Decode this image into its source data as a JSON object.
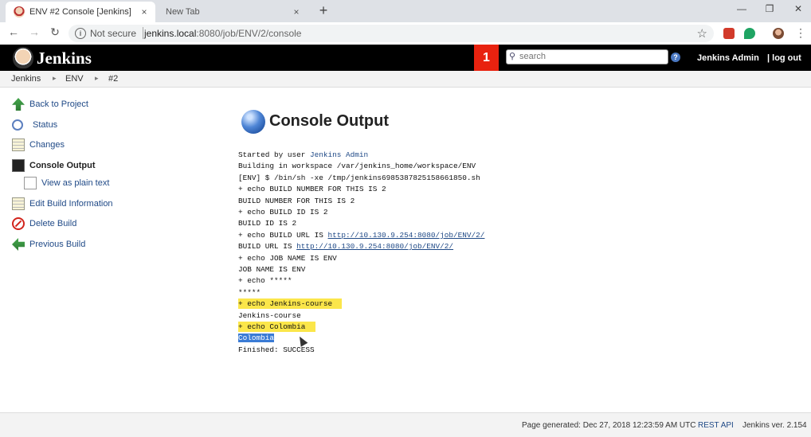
{
  "browser": {
    "tabs": [
      {
        "title": "ENV #2 Console [Jenkins]",
        "close": "×"
      },
      {
        "title": "New Tab",
        "close": "×"
      }
    ],
    "new_tab": "+",
    "window_controls": {
      "minimize": "—",
      "restore": "❐",
      "close": "✕"
    },
    "nav": {
      "back": "←",
      "forward": "→",
      "reload": "↻"
    },
    "address": {
      "security_label": "Not secure",
      "host": "jenkins.local",
      "rest": ":8080/job/ENV/2/console"
    },
    "star": "☆",
    "menu": "⋮"
  },
  "header": {
    "title": "Jenkins",
    "notification_count": "1",
    "search": {
      "placeholder": "search",
      "icon": "search-icon"
    },
    "help": "?",
    "user": "Jenkins Admin",
    "logout": "| log out"
  },
  "breadcrumbs": [
    "Jenkins",
    "ENV",
    "#2"
  ],
  "breadcrumb_separator": "▸",
  "sidebar": {
    "items": [
      {
        "label": "Back to Project",
        "icon": "up-arrow-icon"
      },
      {
        "label": "Status",
        "icon": "search-icon"
      },
      {
        "label": "Changes",
        "icon": "notepad-icon"
      },
      {
        "label": "Console Output",
        "icon": "terminal-icon"
      },
      {
        "label": "View as plain text",
        "icon": "page-icon"
      },
      {
        "label": "Edit Build Information",
        "icon": "notepad-icon"
      },
      {
        "label": "Delete Build",
        "icon": "delete-icon"
      },
      {
        "label": "Previous Build",
        "icon": "left-arrow-icon"
      }
    ]
  },
  "main": {
    "title": "Console Output",
    "console": {
      "started_prefix": "Started by user ",
      "started_user": "Jenkins Admin",
      "lines_a": [
        "Building in workspace /var/jenkins_home/workspace/ENV",
        "[ENV] $ /bin/sh -xe /tmp/jenkins6985387825158661850.sh",
        "+ echo BUILD NUMBER FOR THIS IS 2",
        "BUILD NUMBER FOR THIS IS 2",
        "+ echo BUILD ID IS 2",
        "BUILD ID IS 2"
      ],
      "build_url_echo_prefix": "+ echo BUILD URL IS ",
      "build_url_prefix": "BUILD URL IS ",
      "build_url": "http://10.130.9.254:8080/job/ENV/2/",
      "lines_b": [
        "+ echo JOB NAME IS ENV",
        "JOB NAME IS ENV",
        "+ echo *****",
        "*****"
      ],
      "hl_echo_course": "+ echo Jenkins-course",
      "course_output": "Jenkins-course",
      "hl_echo_colombia": "+ echo Colombia",
      "colombia_output": "Colombia",
      "finished": "Finished: SUCCESS"
    }
  },
  "footer": {
    "generated": "Page generated: Dec 27, 2018 12:23:59 AM UTC",
    "rest_api": "REST API",
    "version": "Jenkins ver. 2.154"
  },
  "colors": {
    "header_bg": "#000000",
    "badge": "#e8220f",
    "link": "#204a87",
    "highlight": "#fbe64a",
    "selection": "#3a7bd5"
  }
}
